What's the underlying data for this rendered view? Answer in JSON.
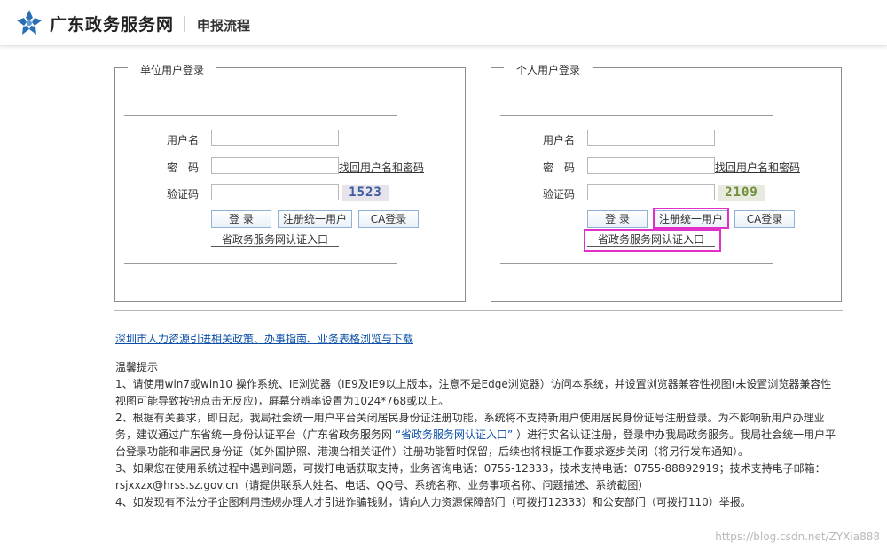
{
  "header": {
    "site_name": "广东政务服务网",
    "page_title": "申报流程",
    "logo_icon": "star-flower-logo-icon",
    "logo_color": "#2a6fb3"
  },
  "unit_login": {
    "legend": "单位用户登录",
    "username_label": "用户名",
    "password_label": "密　码",
    "captcha_label": "验证码",
    "username_value": "",
    "password_value": "",
    "captcha_value": "",
    "recover_link": "找回用户名和密码",
    "captcha_code": "1523",
    "login_button": "登 录",
    "register_button": "注册统一用户",
    "ca_button": "CA登录",
    "portal_link": "省政务服务网认证入口"
  },
  "personal_login": {
    "legend": "个人用户登录",
    "username_label": "用户名",
    "password_label": "密　码",
    "captcha_label": "验证码",
    "username_value": "",
    "password_value": "",
    "captcha_value": "",
    "recover_link": "找回用户名和密码",
    "captcha_code": "2109",
    "login_button": "登 录",
    "register_button": "注册统一用户",
    "ca_button": "CA登录",
    "portal_link": "省政务服务网认证入口"
  },
  "highlight_color": "#e030c8",
  "policy_link": "深圳市人力资源引进相关政策、办事指南、业务表格浏览与下载",
  "tips": {
    "title": "温馨提示",
    "item1": "1、请使用win7或win10 操作系统、IE浏览器（IE9及IE9以上版本，注意不是Edge浏览器）访问本系统，并设置浏览器兼容性视图(未设置浏览器兼容性视图可能导致按钮点击无反应)，屏幕分辨率设置为1024*768或以上。",
    "item2_before": "2、根据有关要求，即日起，我局社会统一用户平台关闭居民身份证注册功能，系统将不支持新用户使用居民身份证号注册登录。为不影响新用户办理业务，建议通过广东省统一身份认证平台（广东省政务服务网 ",
    "item2_link": "“省政务服务网认证入口”",
    "item2_after": " ）进行实名认证注册，登录申办我局政务服务。我局社会统一用户平台登录功能和非居民身份证（如外国护照、港澳台相关证件）注册功能暂时保留，后续也将根据工作要求逐步关闭（将另行发布通知）。",
    "item3": "3、如果您在使用系统过程中遇到问题，可拨打电话获取支持，业务咨询电话：0755-12333，技术支持电话：0755-88892919；技术支持电子邮箱：rsjxxzx@hrss.sz.gov.cn（请提供联系人姓名、电话、QQ号、系统名称、业务事项名称、问题描述、系统截图）",
    "item4": "4、如发现有不法分子企图利用违规办理人才引进诈骗钱财，请向人力资源保障部门（可拨打12333）和公安部门（可拨打110）举报。"
  },
  "watermark": "https://blog.csdn.net/ZYXia888"
}
